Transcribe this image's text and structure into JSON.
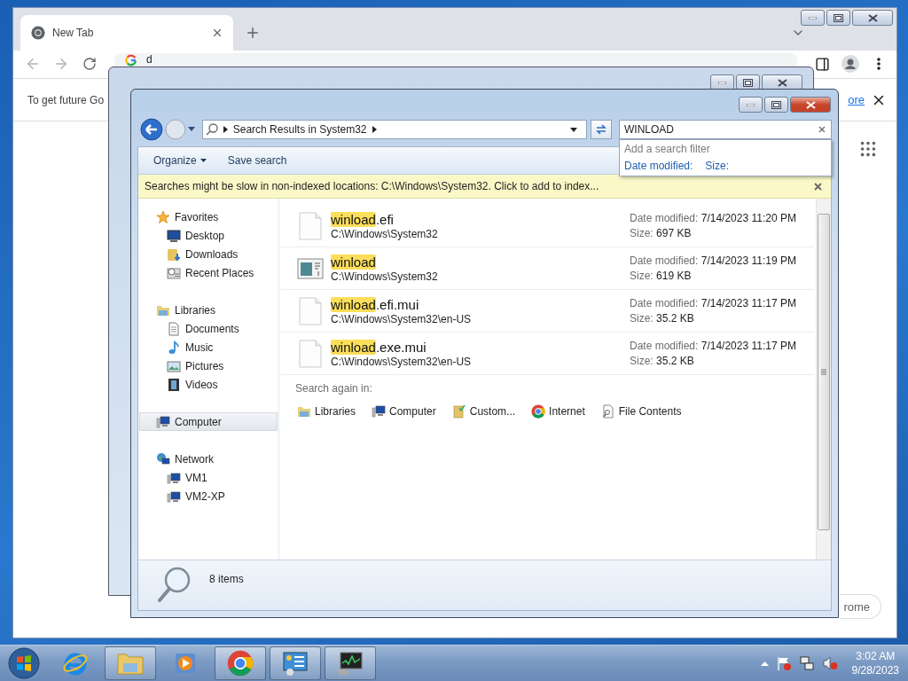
{
  "browser": {
    "tab": {
      "title": "New Tab"
    },
    "address": {
      "value": "d"
    },
    "infobar": {
      "text": "To get future Go",
      "link": "ore"
    },
    "corner_button": "rome"
  },
  "explorer": {
    "address_path": "Search Results in System32",
    "search": {
      "value": "WINLOAD"
    },
    "search_filters": {
      "hint": "Add a search filter",
      "filters": [
        "Date modified:",
        "Size:"
      ]
    },
    "toolbar": [
      {
        "label": "Organize",
        "kind": "menu"
      },
      {
        "label": "Save search",
        "kind": "button"
      }
    ],
    "notice": "Searches might be slow in non-indexed locations: C:\\Windows\\System32. Click to add to index...",
    "sidebar": [
      {
        "label": "Favorites",
        "kind": "favorites",
        "selected": false,
        "children": [
          {
            "label": "Desktop",
            "kind": "desktop",
            "selected": false
          },
          {
            "label": "Downloads",
            "kind": "downloads",
            "selected": false
          },
          {
            "label": "Recent Places",
            "kind": "recent",
            "selected": false
          }
        ]
      },
      {
        "label": "Libraries",
        "kind": "libraries",
        "selected": false,
        "children": [
          {
            "label": "Documents",
            "kind": "documents",
            "selected": false
          },
          {
            "label": "Music",
            "kind": "music",
            "selected": false
          },
          {
            "label": "Pictures",
            "kind": "pictures",
            "selected": false
          },
          {
            "label": "Videos",
            "kind": "videos",
            "selected": false
          }
        ]
      },
      {
        "label": "Computer",
        "kind": "computer",
        "selected": true
      },
      {
        "label": "Network",
        "kind": "network",
        "selected": false,
        "children": [
          {
            "label": "VM1",
            "kind": "pc",
            "selected": false
          },
          {
            "label": "VM2-XP",
            "kind": "pc",
            "selected": false
          }
        ]
      }
    ],
    "results": [
      {
        "kind": "file",
        "match": "winload",
        "suffix": ".efi",
        "path": "C:\\Windows\\System32",
        "date_label": "Date modified:",
        "date": "7/14/2023 11:20 PM",
        "size_label": "Size:",
        "size": "697 KB"
      },
      {
        "kind": "app",
        "match": "winload",
        "path": "C:\\Windows\\System32",
        "date_label": "Date modified:",
        "date": "7/14/2023 11:19 PM",
        "size_label": "Size:",
        "size": "619 KB"
      },
      {
        "kind": "file",
        "match": "winload",
        "suffix": ".efi.mui",
        "path": "C:\\Windows\\System32\\en-US",
        "date_label": "Date modified:",
        "date": "7/14/2023 11:17 PM",
        "size_label": "Size:",
        "size": "35.2 KB"
      },
      {
        "kind": "file",
        "match": "winload",
        "suffix": ".exe.mui",
        "path": "C:\\Windows\\System32\\en-US",
        "date_label": "Date modified:",
        "date": "7/14/2023 11:17 PM",
        "size_label": "Size:",
        "size": "35.2 KB"
      }
    ],
    "search_again": {
      "label": "Search again in:",
      "locations": [
        {
          "label": "Libraries",
          "kind": "libraries"
        },
        {
          "label": "Computer",
          "kind": "computer"
        },
        {
          "label": "Custom...",
          "kind": "custom"
        },
        {
          "label": "Internet",
          "kind": "internet"
        },
        {
          "label": "File Contents",
          "kind": "contents"
        }
      ]
    },
    "status": "8 items"
  },
  "taskbar": {
    "apps": [
      {
        "kind": "ie",
        "running": false
      },
      {
        "kind": "explorer",
        "running": true
      },
      {
        "kind": "media",
        "running": false
      },
      {
        "kind": "chrome",
        "running": true
      },
      {
        "kind": "control",
        "running": true
      },
      {
        "kind": "monitor",
        "running": true
      }
    ],
    "time": "3:02 AM",
    "date": "9/28/2023"
  }
}
